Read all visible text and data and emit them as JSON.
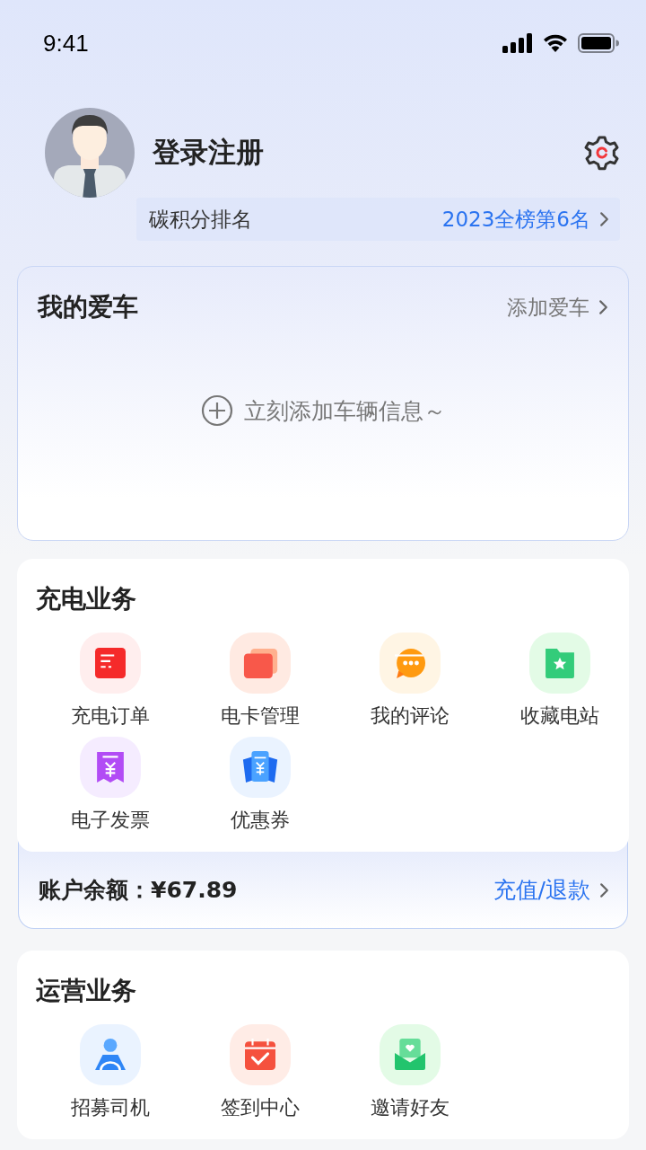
{
  "status_bar": {
    "time": "9:41"
  },
  "profile": {
    "name": "登录注册",
    "rank_label": "碳积分排名",
    "rank_value": "2023全榜第6名"
  },
  "my_car": {
    "title": "我的爱车",
    "action": "添加爱车",
    "empty_text": "立刻添加车辆信息～"
  },
  "charging": {
    "title": "充电业务",
    "items": [
      {
        "label": "充电订单",
        "kind": "order"
      },
      {
        "label": "电卡管理",
        "kind": "cards"
      },
      {
        "label": "我的评论",
        "kind": "comment"
      },
      {
        "label": "收藏电站",
        "kind": "favorite"
      },
      {
        "label": "电子发票",
        "kind": "invoice"
      },
      {
        "label": "优惠券",
        "kind": "coupon"
      }
    ]
  },
  "balance": {
    "label": "账户余额：¥67.89",
    "action": "充值/退款"
  },
  "operations": {
    "title": "运营业务",
    "items": [
      {
        "label": "招募司机",
        "kind": "driver"
      },
      {
        "label": "签到中心",
        "kind": "checkin"
      },
      {
        "label": "邀请好友",
        "kind": "invite"
      }
    ]
  }
}
